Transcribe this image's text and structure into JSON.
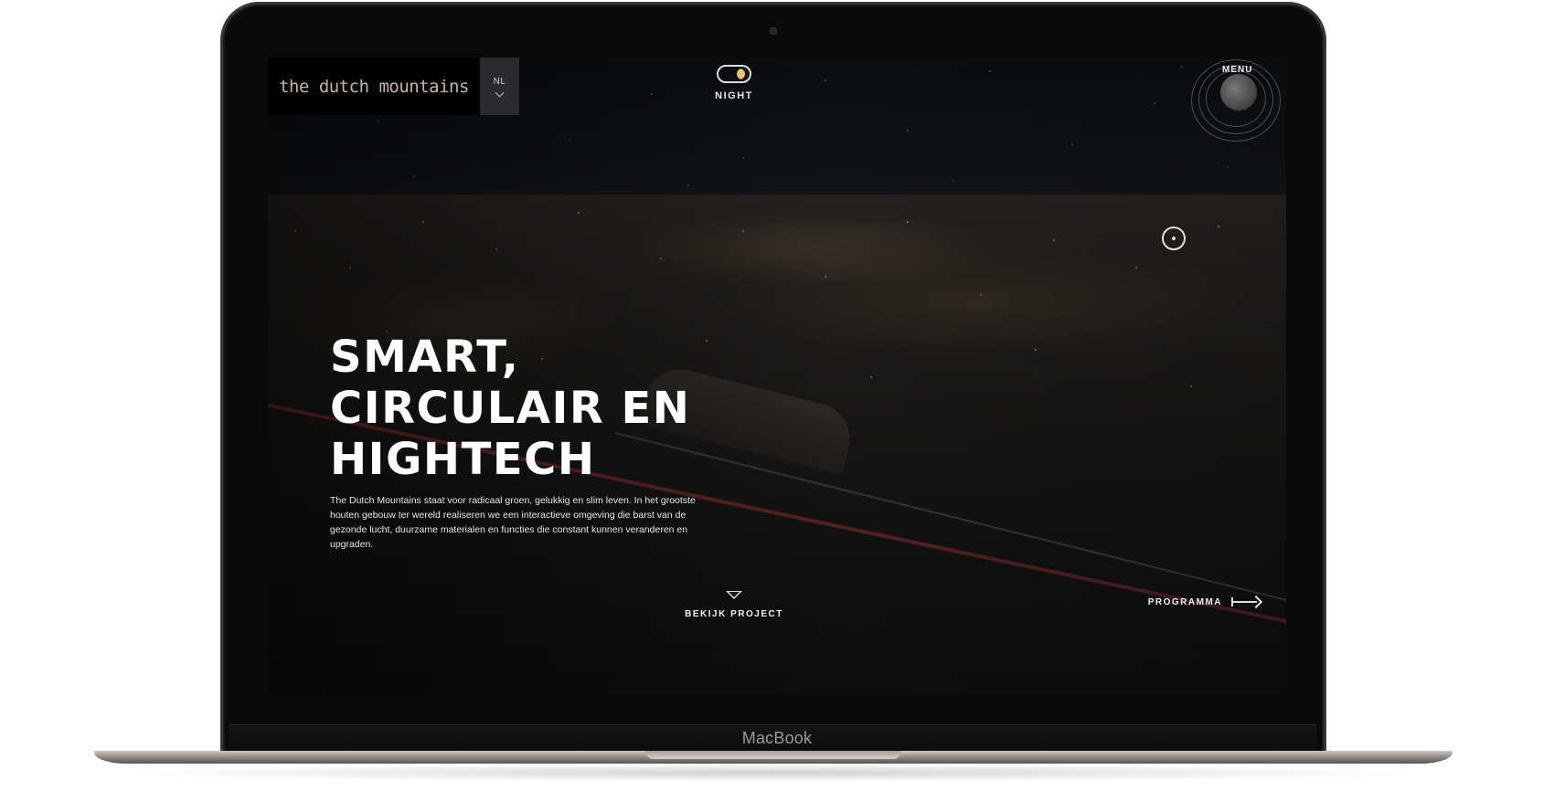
{
  "device": {
    "brand": "MacBook"
  },
  "header": {
    "logo": "the dutch mountains",
    "language": "NL",
    "mode_label": "NIGHT",
    "menu_label": "MENU"
  },
  "hero": {
    "headline": [
      "SMART,",
      "CIRCULAIR EN",
      "HIGHTECH"
    ],
    "intro": "The Dutch Mountains staat voor radicaal groen, gelukkig en slim leven. In het grootste houten gebouw ter wereld realiseren we een interactieve omgeving die barst van de gezonde lucht, duurzame materialen en functies die constant kunnen veranderen en upgraden."
  },
  "footer_actions": {
    "scroll_label": "BEKIJK PROJECT",
    "program_label": "PROGRAMMA"
  },
  "icons": {
    "toggle": "moon-toggle-icon",
    "lang": "chevron-down-icon",
    "menu": "moon-menu-icon",
    "compass": "compass-icon",
    "scroll": "chevron-down-icon",
    "program": "arrow-right-icon"
  },
  "colors": {
    "logo": "#c8b59a",
    "moon": "#e9c46a",
    "text": "#ffffff"
  }
}
